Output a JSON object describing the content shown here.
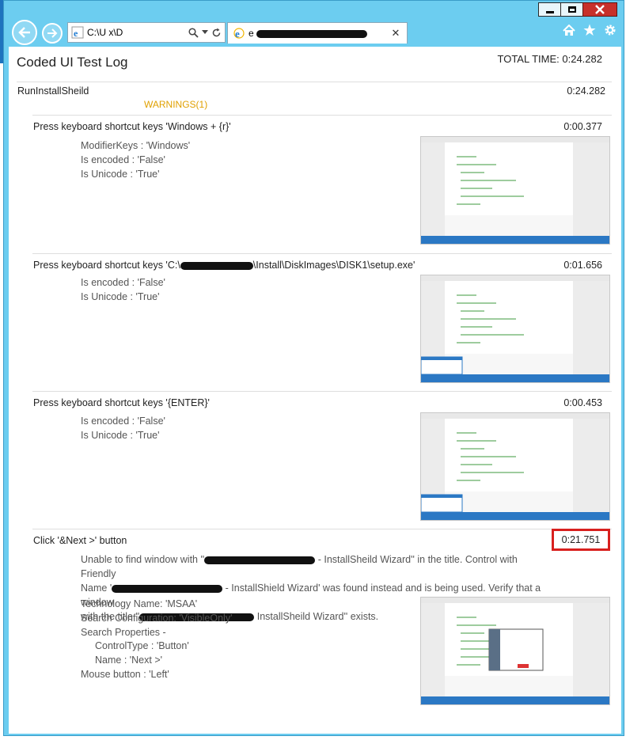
{
  "browser": {
    "address_text": "C:\\U        x\\D",
    "tab_title": "e",
    "colors": {
      "frame": "#6ccdf0",
      "close": "#c7302a",
      "highlight": "#d8201e",
      "warning": "#e0a000"
    }
  },
  "log": {
    "title": "Coded UI Test Log",
    "total_time": "TOTAL TIME: 0:24.282",
    "test_name": "RunInstallSheild",
    "test_duration": "0:24.282",
    "warnings": "WARNINGS(1)"
  },
  "steps": [
    {
      "title": "Press keyboard shortcut keys 'Windows + {r}'",
      "duration": "0:00.377",
      "props": [
        "ModifierKeys : 'Windows'",
        "Is encoded : 'False'",
        "Is Unicode : 'True'"
      ]
    },
    {
      "title_prefix": "Press keyboard shortcut keys 'C:\\",
      "title_suffix": "\\Install\\DiskImages\\DISK1\\setup.exe'",
      "duration": "0:01.656",
      "props": [
        "Is encoded : 'False'",
        "Is Unicode : 'True'"
      ]
    },
    {
      "title": "Press keyboard shortcut keys '{ENTER}'",
      "duration": "0:00.453",
      "props": [
        "Is encoded : 'False'",
        "Is Unicode : 'True'"
      ]
    },
    {
      "title": "Click '&Next >' button",
      "duration": "0:21.751",
      "msg_1a": "Unable to find window with ''",
      "msg_1b": " - InstallSheild Wizard'' in the title. Control with Friendly",
      "msg_2a": "Name '",
      "msg_2b": " - InstallShield Wizard' was found instead and is being used. Verify that a window",
      "msg_3a": "with the title ''",
      "msg_3b": " InstallSheild Wizard'' exists.",
      "props": [
        "Technology Name: 'MSAA'",
        "Search Configuration: 'VisibleOnly'",
        "Search Properties -",
        "ControlType : 'Button'",
        "Name : 'Next >'",
        "Mouse button : 'Left'"
      ]
    }
  ]
}
